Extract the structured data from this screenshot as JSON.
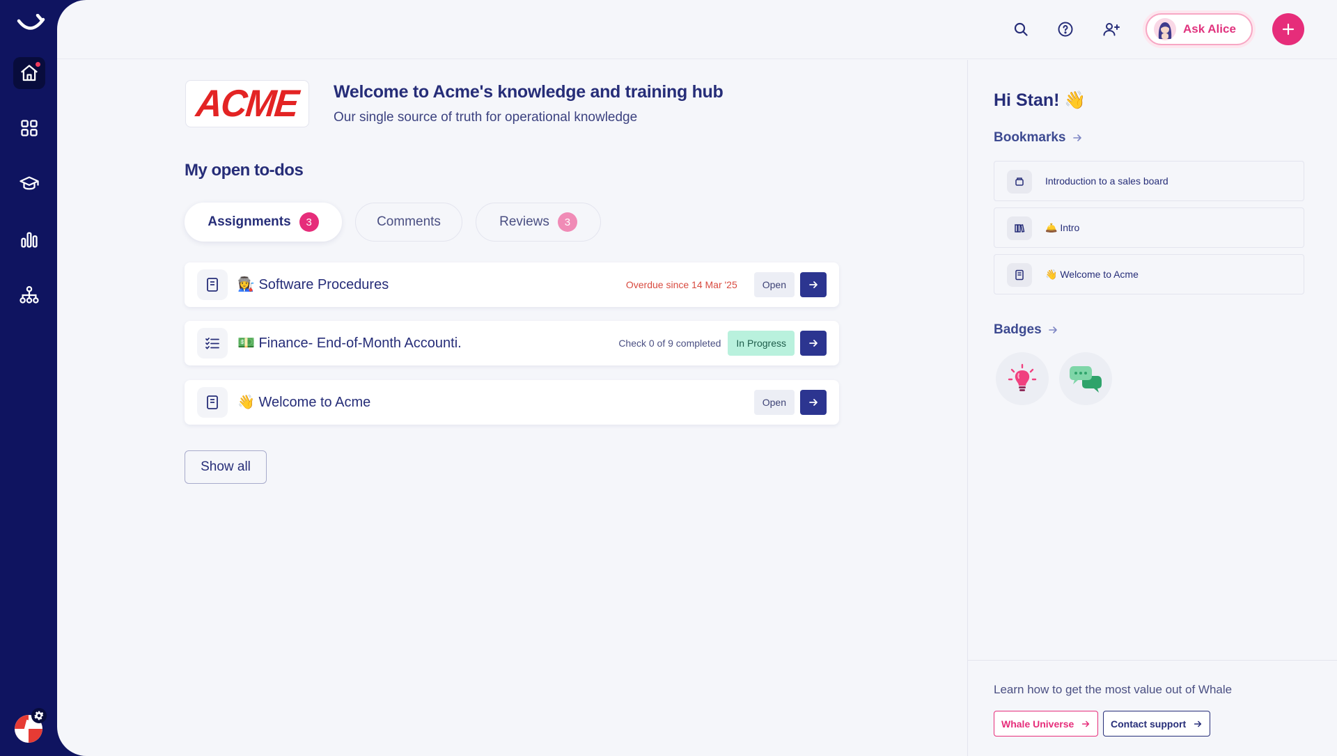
{
  "colors": {
    "sidebar": "#0f1460",
    "accent": "#e62d7a",
    "navy": "#2c3590",
    "overdue": "#d84a3f",
    "in_progress": "#b9f1dd"
  },
  "sidebar": {
    "icons": [
      "smile-logo-icon",
      "home-icon",
      "grid-icon",
      "graduation-cap-icon",
      "bar-chart-icon",
      "org-chart-icon"
    ],
    "active": "home"
  },
  "topbar": {
    "ask_alice_label": "Ask Alice"
  },
  "hub": {
    "logo_text": "ACME",
    "title": "Welcome to Acme's knowledge and training hub",
    "subtitle": "Our single source of truth for operational knowledge"
  },
  "todos": {
    "title": "My open to-dos",
    "tabs": [
      {
        "label": "Assignments",
        "count": "3"
      },
      {
        "label": "Comments",
        "count": ""
      },
      {
        "label": "Reviews",
        "count": "3"
      }
    ],
    "items": [
      {
        "title": "👩‍🏭 Software Procedures",
        "meta": "Overdue since 14 Mar '25",
        "status": "Open",
        "icon": "document-icon"
      },
      {
        "title": "💵 Finance- End-of-Month Accounti.",
        "meta": "Check 0 of 9 completed",
        "status": "In Progress",
        "icon": "checklist-icon"
      },
      {
        "title": "👋 Welcome to Acme",
        "meta": "",
        "status": "Open",
        "icon": "document-icon"
      }
    ],
    "show_all_label": "Show all"
  },
  "panel": {
    "greeting": "Hi Stan! 👋",
    "bookmarks_title": "Bookmarks",
    "bookmarks": [
      {
        "label": "Introduction to a sales board",
        "icon": "board-icon"
      },
      {
        "label": "🛎️ Intro",
        "icon": "library-icon"
      },
      {
        "label": "👋 Welcome to Acme",
        "icon": "document-icon"
      }
    ],
    "badges_title": "Badges",
    "badges": [
      "lightbulb-badge-icon",
      "chat-bubbles-badge-icon"
    ],
    "learn_text": "Learn how to get the most value out of Whale",
    "whale_universe_label": "Whale Universe",
    "contact_support_label": "Contact support"
  }
}
